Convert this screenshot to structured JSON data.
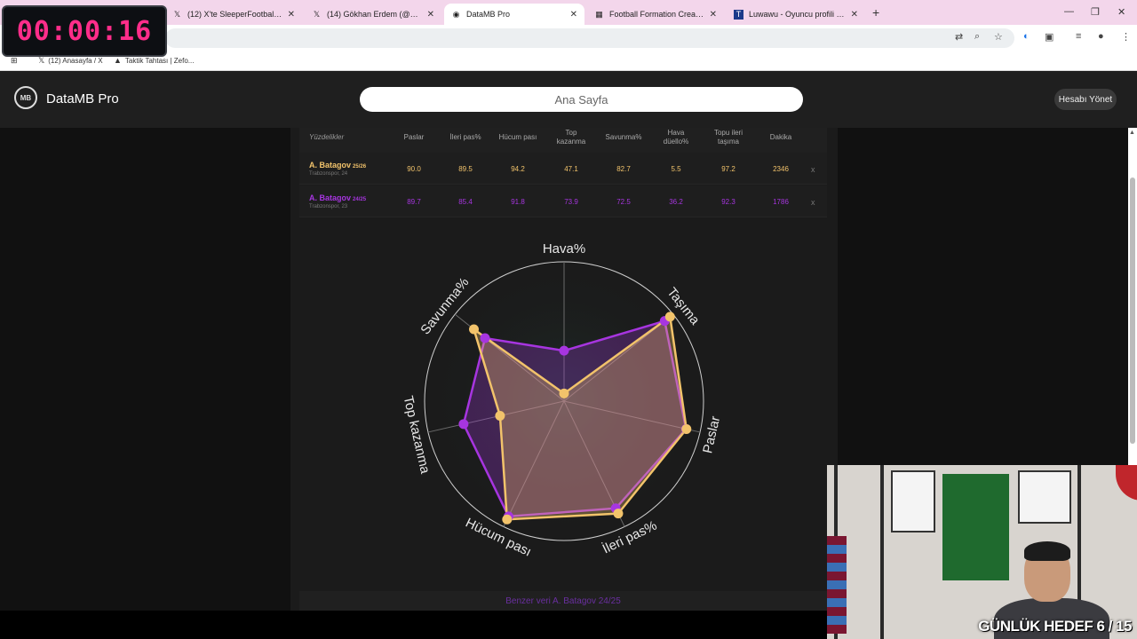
{
  "timer": "00:00:16",
  "browser": {
    "tabs": [
      {
        "icon": "x-icon",
        "title": "(12) X'te SleeperFootballNews: \""
      },
      {
        "icon": "x-icon",
        "title": "(14) Gökhan Erdem (@zforzamb"
      },
      {
        "icon": "datamb-icon",
        "title": "DataMB Pro",
        "active": true
      },
      {
        "icon": "formation-icon",
        "title": "Football Formation Creator: Re"
      },
      {
        "icon": "luwawu-icon",
        "title": "Luwawu - Oyuncu profili | Tran"
      }
    ],
    "bookmarks": [
      {
        "icon": "x-icon",
        "label": "(12) Anasayfa / X"
      },
      {
        "icon": "zeforo-icon",
        "label": "Taktik Tahtası | Zefo..."
      }
    ]
  },
  "app": {
    "logo_text": "DataMB Pro",
    "logo_mark": "MB",
    "home_label": "Ana Sayfa",
    "account_label": "Hesabı Yönet"
  },
  "table": {
    "corner_label": "Yüzdelikler",
    "columns": [
      "Paslar",
      "İleri pas%",
      "Hücum pası",
      "Top kazanma",
      "Savunma%",
      "Hava düello%",
      "Topu ileri taşıma",
      "Dakika"
    ],
    "rows": [
      {
        "name": "A. Batagov",
        "season": "25/26",
        "team": "Trabzonspor, 24",
        "values": [
          "90.0",
          "89.5",
          "94.2",
          "47.1",
          "82.7",
          "5.5",
          "97.2",
          "2346"
        ],
        "remove": "x",
        "color": "#f2c36b"
      },
      {
        "name": "A. Batagov",
        "season": "24/25",
        "team": "Trabzonspor, 23",
        "values": [
          "89.7",
          "85.4",
          "91.8",
          "73.9",
          "72.5",
          "36.2",
          "92.3",
          "1786"
        ],
        "remove": "x",
        "color": "#a735e0"
      }
    ]
  },
  "chart_data": {
    "type": "radar",
    "axes": [
      "Hava%",
      "Taşıma",
      "Paslar",
      "İleri pas%",
      "Hücum pası",
      "Top kazanma",
      "Savunma%"
    ],
    "range": [
      0,
      100
    ],
    "series": [
      {
        "name": "A. Batagov 25/26",
        "color": "#f2c36b",
        "values": [
          5.5,
          97.2,
          90.0,
          89.5,
          94.2,
          47.1,
          82.7
        ]
      },
      {
        "name": "A. Batagov 24/25",
        "color": "#a735e0",
        "values": [
          36.2,
          92.3,
          89.7,
          85.4,
          91.8,
          73.9,
          72.5
        ]
      }
    ]
  },
  "footer": "Benzer veri A. Batagov 24/25",
  "stream": {
    "goal": "GÜNLÜK HEDEF 6 / 15"
  }
}
